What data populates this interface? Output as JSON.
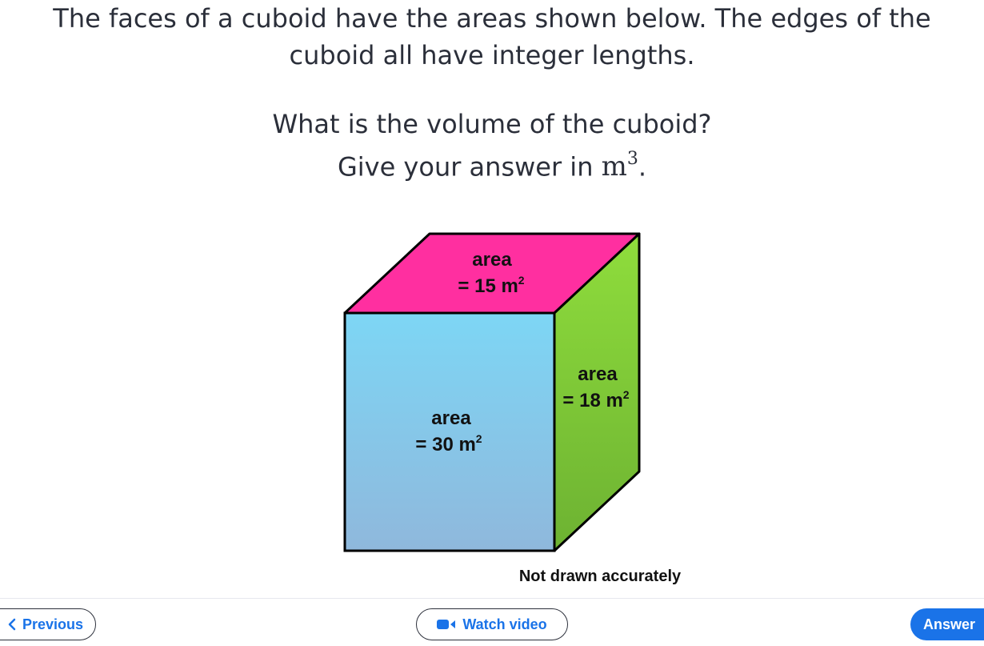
{
  "question": {
    "line1": "The faces of a cuboid have the areas shown below. The edges of the",
    "line2": "cuboid all have integer lengths.",
    "line3": "What is the volume of the cuboid?",
    "line4_prefix": "Give your answer in",
    "unit_base": "m",
    "unit_exp": "3",
    "line4_suffix": "."
  },
  "figure": {
    "top_face": {
      "label": "area",
      "value": "= 15 m",
      "exp": "2",
      "color": "#ff2fa0"
    },
    "front_face": {
      "label": "area",
      "value": "= 30 m",
      "exp": "2",
      "color_top": "#7dd6f5",
      "color_bottom": "#8fb8dc"
    },
    "side_face": {
      "label": "area",
      "value": "= 18 m",
      "exp": "2",
      "color_top": "#8fdd3c",
      "color_bottom": "#6db232"
    },
    "note": "Not drawn accurately"
  },
  "footer": {
    "previous_label": "Previous",
    "video_label": "Watch video",
    "answer_label": "Answer"
  },
  "colors": {
    "accent": "#1a73e8",
    "text": "#2b2f3a"
  },
  "icons": {
    "previous": "chevron-left-icon",
    "video": "video-camera-icon"
  }
}
